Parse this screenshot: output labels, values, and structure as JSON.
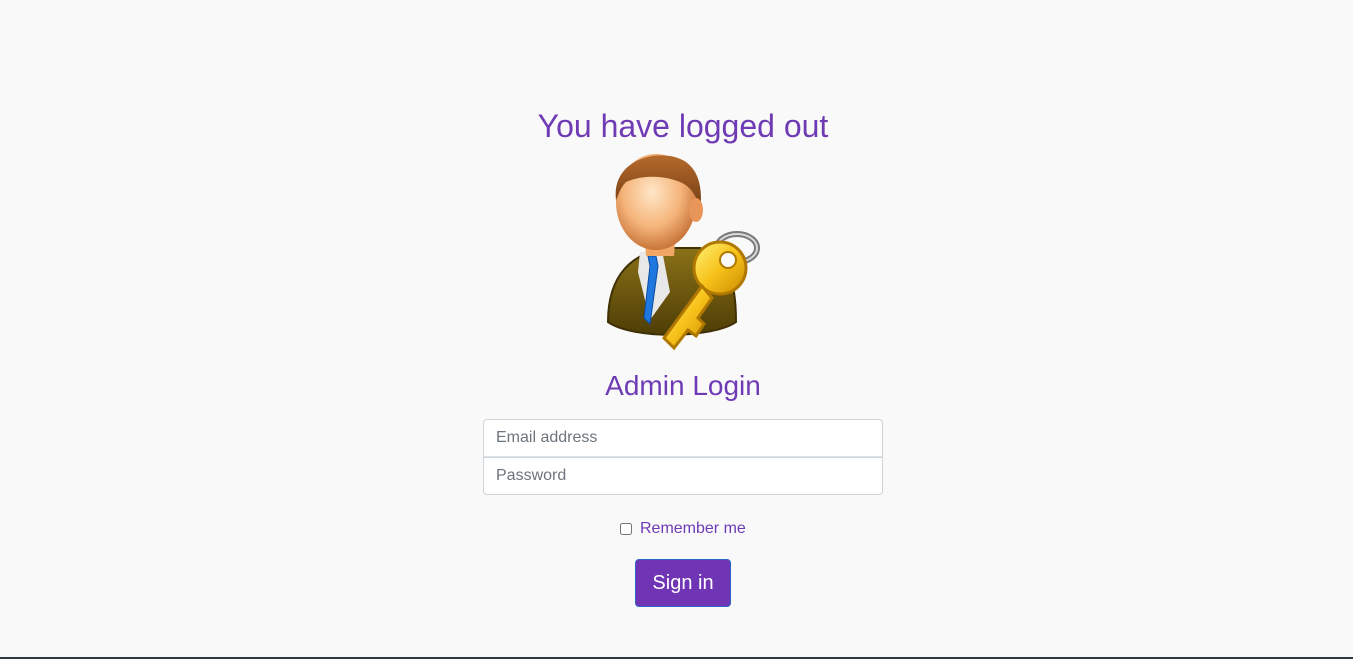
{
  "page": {
    "logout_message": "You have logged out",
    "login_heading": "Admin Login",
    "avatar_icon": "admin-user-key-icon"
  },
  "form": {
    "email_placeholder": "Email address",
    "password_placeholder": "Password",
    "remember_label": "Remember me",
    "remember_checked": false,
    "signin_label": "Sign in"
  },
  "colors": {
    "accent": "#6f3bb5",
    "background": "#f9f9f9",
    "button_border": "#2f63c7"
  }
}
